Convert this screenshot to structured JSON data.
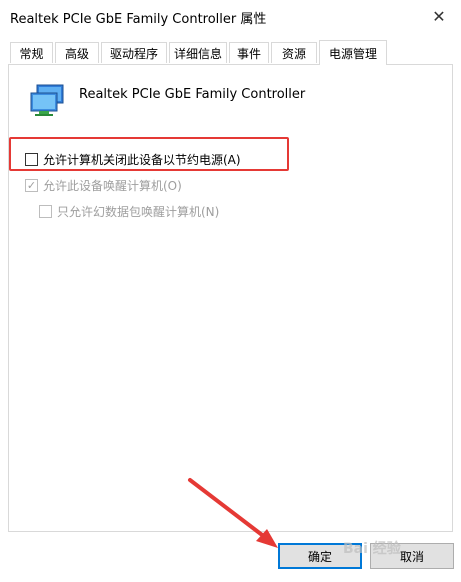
{
  "window": {
    "title": "Realtek PCIe GbE Family Controller 属性",
    "close_glyph": "✕"
  },
  "tabs": [
    {
      "label": "常规"
    },
    {
      "label": "高级"
    },
    {
      "label": "驱动程序"
    },
    {
      "label": "详细信息"
    },
    {
      "label": "事件"
    },
    {
      "label": "资源"
    },
    {
      "label": "电源管理",
      "active": true
    }
  ],
  "device": {
    "name": "Realtek PCIe GbE Family Controller",
    "icon": "network-adapter-icon"
  },
  "options": [
    {
      "label": "允许计算机关闭此设备以节约电源(A)",
      "checked": false,
      "enabled": true
    },
    {
      "label": "允许此设备唤醒计算机(O)",
      "checked": true,
      "enabled": false
    },
    {
      "label": "只允许幻数据包唤醒计算机(N)",
      "checked": false,
      "enabled": false
    }
  ],
  "buttons": {
    "ok": "确定",
    "cancel": "取消"
  },
  "watermark": "Bai 经验",
  "colors": {
    "highlight": "#e53935",
    "default_button_border": "#0078d7",
    "arrow": "#e53935"
  }
}
